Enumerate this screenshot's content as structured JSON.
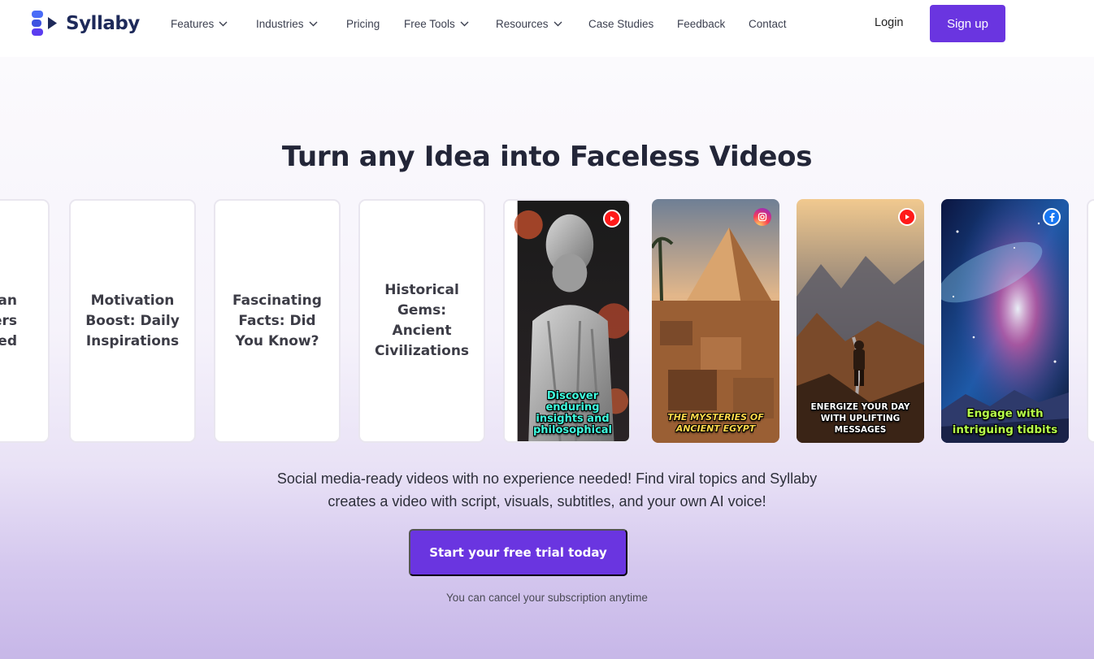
{
  "brand": {
    "name": "Syllaby",
    "color": "#6a35e0"
  },
  "nav": {
    "items": [
      {
        "label": "Features",
        "dropdown": true
      },
      {
        "label": "Industries",
        "dropdown": true
      },
      {
        "label": "Pricing",
        "dropdown": false
      },
      {
        "label": "Free Tools",
        "dropdown": true
      },
      {
        "label": "Resources",
        "dropdown": true
      },
      {
        "label": "Case Studies",
        "dropdown": false
      },
      {
        "label": "Feedback",
        "dropdown": false
      },
      {
        "label": "Contact",
        "dropdown": false
      }
    ],
    "login": "Login",
    "signup": "Sign up"
  },
  "hero": {
    "title": "Turn any Idea into Faceless Videos",
    "topic_cards": [
      {
        "lines": [
          "an",
          "ers",
          "ed"
        ]
      },
      {
        "lines": [
          "Motivation",
          "Boost: Daily",
          "Inspirations"
        ]
      },
      {
        "lines": [
          "Fascinating",
          "Facts: Did",
          "You Know?"
        ]
      },
      {
        "lines": [
          "Historical",
          "Gems:",
          "Ancient",
          "Civilizations"
        ]
      }
    ],
    "video_cards": [
      {
        "platform": "youtube",
        "caption": [
          "Discover",
          "enduring",
          "insights and",
          "philosophical"
        ],
        "caption_color": "#3fffe0",
        "scene": "stoic-statue"
      },
      {
        "platform": "instagram",
        "caption": [
          "THE MYSTERIES OF",
          "ANCIENT EGYPT"
        ],
        "caption_color": "#ffd84a",
        "scene": "pyramid"
      },
      {
        "platform": "youtube",
        "caption": [
          "ENERGIZE YOUR DAY",
          "WITH UPLIFTING",
          "MESSAGES"
        ],
        "caption_color": "#ffffff",
        "scene": "hiker-canyon"
      },
      {
        "platform": "facebook",
        "caption": [
          "Engage with",
          "intriguing tidbits"
        ],
        "caption_color": "#b6ff4a",
        "scene": "galaxy"
      }
    ],
    "subtitle_lines": [
      "Social media-ready videos with no experience needed! Find viral topics and Syllaby",
      "creates a video with script, visuals, subtitles, and your own AI voice!"
    ],
    "cta": "Start your free trial today",
    "note": "You can cancel your subscription anytime"
  }
}
